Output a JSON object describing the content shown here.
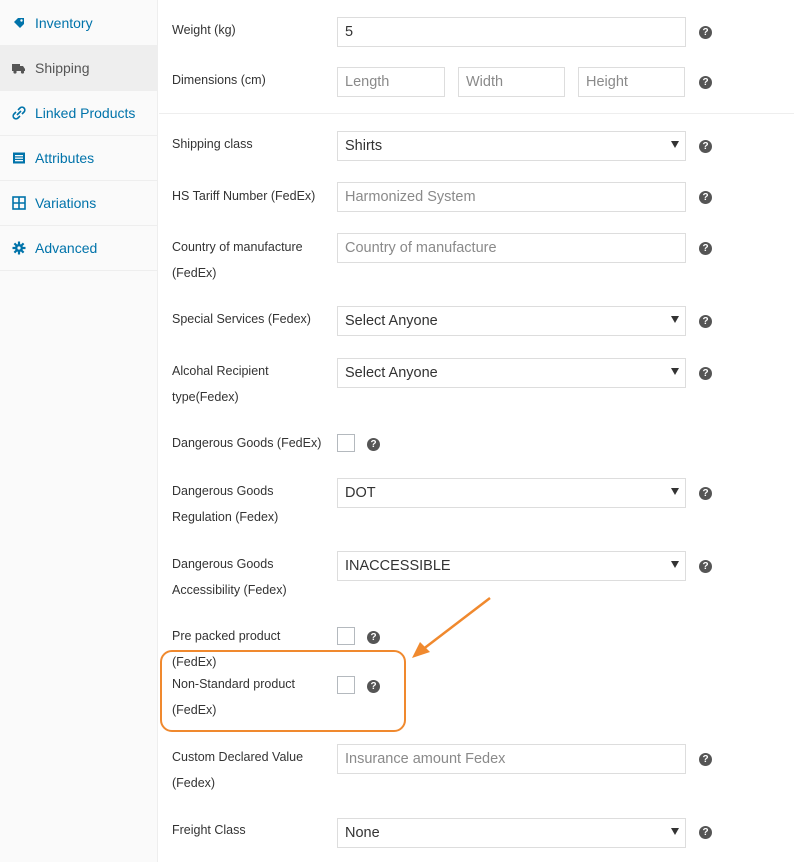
{
  "sidebar": {
    "items": [
      {
        "label": "Inventory",
        "icon": "tag-icon",
        "active": false
      },
      {
        "label": "Shipping",
        "icon": "truck-icon",
        "active": true
      },
      {
        "label": "Linked Products",
        "icon": "link-icon",
        "active": false
      },
      {
        "label": "Attributes",
        "icon": "list-icon",
        "active": false
      },
      {
        "label": "Variations",
        "icon": "grid-icon",
        "active": false
      },
      {
        "label": "Advanced",
        "icon": "gear-icon",
        "active": false
      }
    ]
  },
  "form": {
    "weight": {
      "label": "Weight (kg)",
      "value": "5"
    },
    "dimensions": {
      "label": "Dimensions (cm)",
      "length_placeholder": "Length",
      "width_placeholder": "Width",
      "height_placeholder": "Height"
    },
    "shipping_class": {
      "label": "Shipping class",
      "value": "Shirts"
    },
    "hs_tariff": {
      "label": "HS Tariff Number (FedEx)",
      "placeholder": "Harmonized System"
    },
    "country": {
      "label_line1": "Country of manufacture",
      "label_line2": "(FedEx)",
      "placeholder": "Country of manufacture"
    },
    "special_services": {
      "label": "Special Services (Fedex)",
      "value": "Select Anyone"
    },
    "alcohol": {
      "label_line1": "Alcohal Recipient",
      "label_line2": "type(Fedex)",
      "value": "Select Anyone"
    },
    "dangerous_goods": {
      "label": "Dangerous Goods (FedEx)",
      "checked": false
    },
    "dg_regulation": {
      "label_line1": "Dangerous Goods",
      "label_line2": "Regulation (Fedex)",
      "value": "DOT"
    },
    "dg_accessibility": {
      "label_line1": "Dangerous Goods",
      "label_line2": "Accessibility (Fedex)",
      "value": "INACCESSIBLE"
    },
    "pre_packed": {
      "label": "Pre packed product (FedEx)",
      "checked": false
    },
    "non_standard": {
      "label_line1": "Non-Standard product",
      "label_line2": "(FedEx)",
      "checked": false
    },
    "declared_value": {
      "label_line1": "Custom Declared Value",
      "label_line2": "(Fedex)",
      "placeholder": "Insurance amount Fedex"
    },
    "freight_class": {
      "label": "Freight Class",
      "value": "None"
    }
  },
  "help_glyph": "?",
  "colors": {
    "link": "#0073aa",
    "highlight": "#f0892e",
    "help_bg": "#555555"
  }
}
